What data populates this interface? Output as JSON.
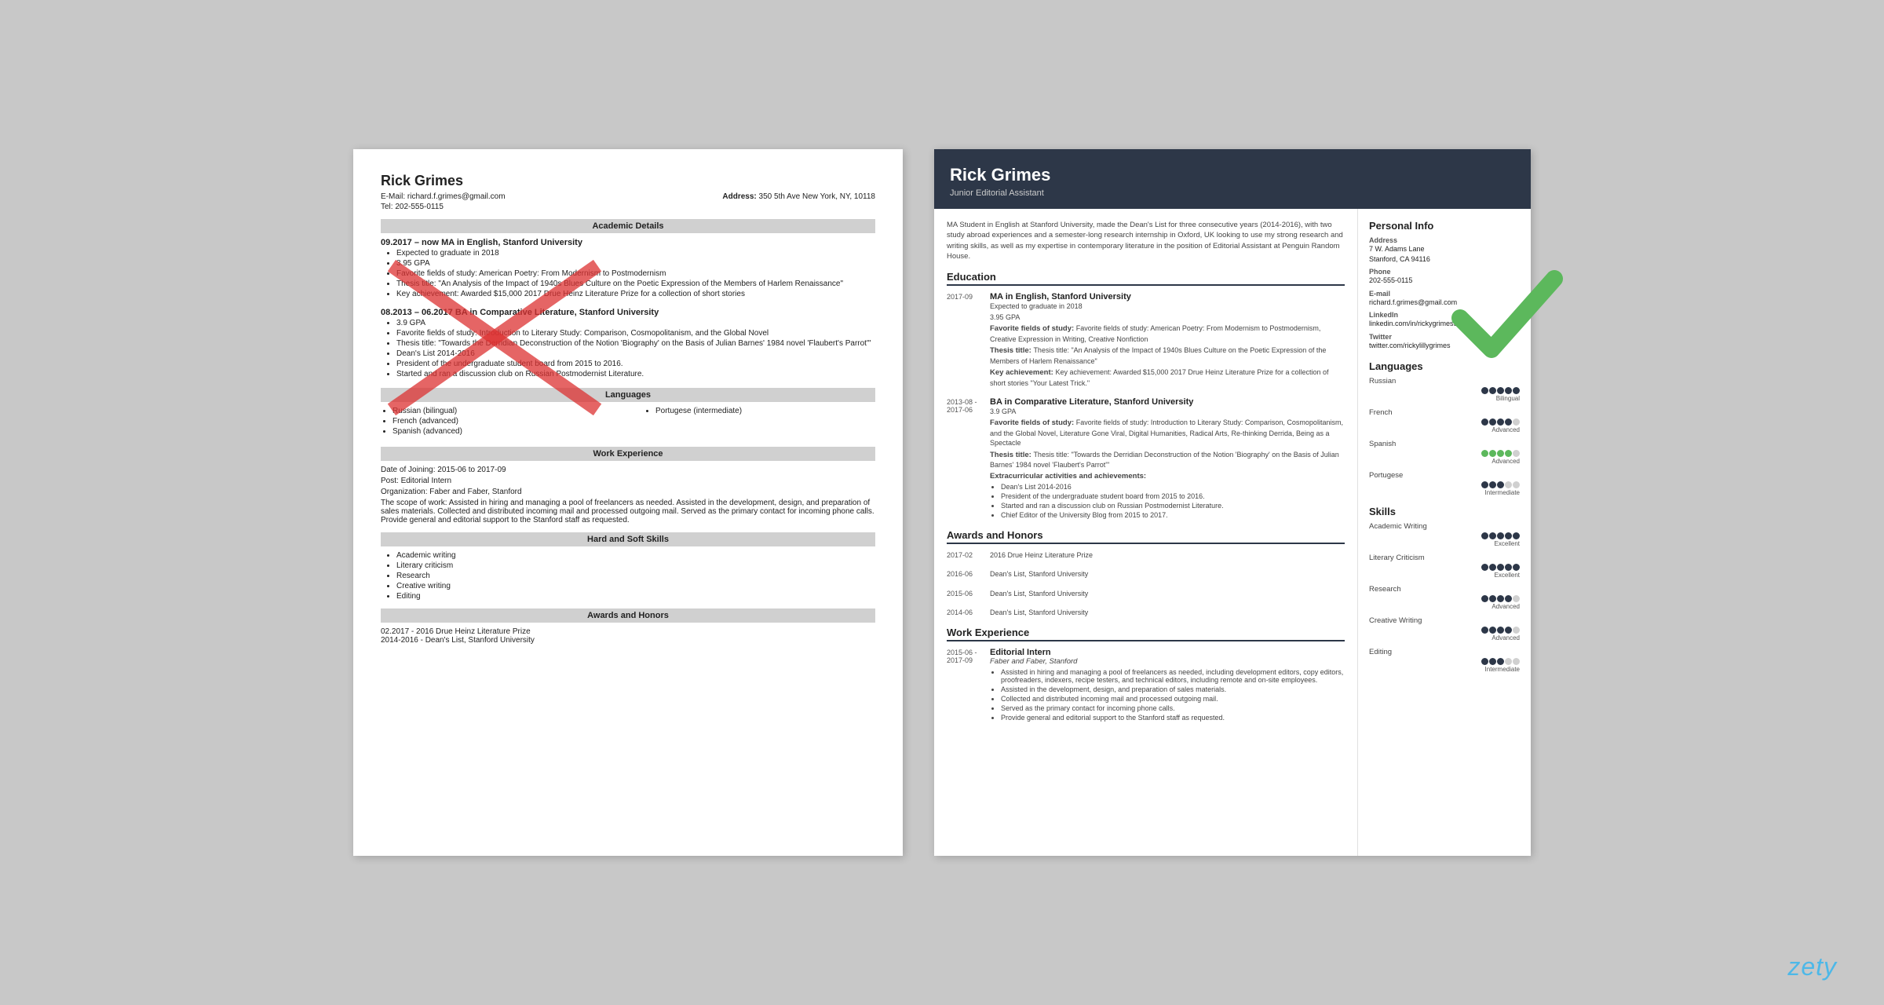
{
  "left_resume": {
    "name": "Rick Grimes",
    "email_label": "E-Mail:",
    "email": "richard.f.grimes@gmail.com",
    "address_label": "Address:",
    "address": "350 5th Ave New York, NY, 10118",
    "tel_label": "Tel:",
    "tel": "202-555-0115",
    "sections": {
      "academic": "Academic Details",
      "languages": "Languages",
      "work": "Work Experience",
      "skills": "Hard and Soft Skills",
      "awards": "Awards and Honors"
    },
    "edu": [
      {
        "date": "09.2017 – now",
        "degree": "MA in English, Stanford University",
        "bullets": [
          "Expected to graduate in 2018",
          "3.95 GPA",
          "Favorite fields of study: American Poetry: From Modernism to Postmodernism",
          "Thesis title: \"An Analysis of the Impact of 1940s Blues Culture on the Poetic Expression of the Members of Harlem Renaissance\"",
          "Key achievement: Awarded $15,000 2017 Drue Heinz Literature Prize for a collection of short stories"
        ]
      },
      {
        "date": "08.2013 – 06.2017",
        "degree": "BA in Comparative Literature, Stanford University",
        "bullets": [
          "3.9 GPA",
          "Favorite fields of study: Introduction to Literary Study: Comparison, Cosmopolitanism, and the Global Novel",
          "Thesis title: \"Towards the Derridian Deconstruction of the Notion 'Biography' on the Basis of Julian Barnes' 1984 novel 'Flaubert's Parrot'\"",
          "Dean's List 2014-2016",
          "President of the undergraduate student board from 2015 to 2016.",
          "Started and ran a discussion club on Russian Postmodernist Literature."
        ]
      }
    ],
    "languages": {
      "col1": [
        "Russian  (bilingual)",
        "French (advanced)",
        "Spanish (advanced)"
      ],
      "col2": [
        "Portugese (intermediate)"
      ]
    },
    "work": {
      "dates": "Date of Joining: 2015-06 to 2017-09",
      "post": "Post: Editorial Intern",
      "org": "Organization: Faber and Faber, Stanford",
      "scope": "The scope of work: Assisted in hiring and managing a pool of freelancers as needed. Assisted in the development, design, and preparation of sales materials. Collected and distributed incoming mail and processed outgoing mail. Served as the primary contact for incoming phone calls.  Provide general and editorial support to the Stanford staff as requested."
    },
    "skills": [
      "Academic writing",
      "Literary criticism",
      "Research",
      "Creative writing",
      "Editing"
    ],
    "awards": [
      "02.2017 - 2016 Drue Heinz Literature Prize",
      "2014-2016 - Dean's List, Stanford University"
    ]
  },
  "right_resume": {
    "name": "Rick Grimes",
    "subtitle": "Junior Editorial Assistant",
    "summary": "MA Student in English at Stanford University, made the Dean's List for three consecutive years (2014-2016), with two study abroad experiences and a semester-long research internship in Oxford, UK looking to use my strong research and writing skills, as well as my expertise in contemporary literature in the position of Editorial Assistant at Penguin Random House.",
    "sections": {
      "education": "Education",
      "awards": "Awards and Honors",
      "work": "Work Experience"
    },
    "education": [
      {
        "date": "2017-09",
        "title": "MA in English, Stanford University",
        "gpa": "Expected to graduate in 2018",
        "gpa2": "3.95 GPA",
        "fields": "Favorite fields of study: American Poetry: From Modernism to Postmodernism, Creative Expression in Writing, Creative Nonfiction",
        "thesis": "Thesis title: \"An Analysis of the Impact of 1940s Blues Culture on the Poetic Expression of the Members of Harlem Renaissance\"",
        "achievement": "Key achievement: Awarded $15,000 2017 Drue Heinz Literature Prize for a collection of short stories \"Your Latest Trick.\""
      },
      {
        "date": "2013-08 - 2017-06",
        "title": "BA in Comparative Literature, Stanford University",
        "gpa": "3.9 GPA",
        "fields": "Favorite fields of study: Introduction to Literary Study: Comparison, Cosmopolitanism, and the Global Novel, Literature Gone Viral, Digital Humanities, Radical Arts, Re-thinking Derrida, Being as a Spectacle",
        "thesis": "Thesis title: \"Towards the Derridian Deconstruction of the Notion 'Biography' on the Basis of Julian Barnes' 1984 novel 'Flaubert's Parrot'\"",
        "extracurricular_label": "Extracurricular activities and achievements:",
        "extracurricular": [
          "Dean's List 2014-2016",
          "President of the undergraduate student board from 2015 to 2016.",
          "Started and ran a discussion club on Russian Postmodernist Literature.",
          "Chief Editor of the University Blog from 2015 to 2017."
        ]
      }
    ],
    "awards": [
      {
        "date": "2017-02",
        "title": "2016 Drue Heinz Literature Prize"
      },
      {
        "date": "2016-06",
        "title": "Dean's List, Stanford University"
      },
      {
        "date": "2015-06",
        "title": "Dean's List, Stanford University"
      },
      {
        "date": "2014-06",
        "title": "Dean's List, Stanford University"
      }
    ],
    "work": [
      {
        "date": "2015-06 - 2017-09",
        "title": "Editorial Intern",
        "org": "Faber and Faber, Stanford",
        "bullets": [
          "Assisted in hiring and managing a pool of freelancers as needed, including development editors, copy editors, proofreaders, indexers, recipe testers, and technical editors, including remote and on-site employees.",
          "Assisted in the development, design, and preparation of sales materials.",
          "Collected and distributed incoming mail and processed outgoing mail.",
          "Served as the primary contact for incoming phone calls.",
          "Provide general and editorial support to the Stanford staff as requested."
        ]
      }
    ],
    "personal_info": {
      "section_title": "Personal Info",
      "address_label": "Address",
      "address": "7 W. Adams Lane\nStanford, CA 94116",
      "phone_label": "Phone",
      "phone": "202-555-0115",
      "email_label": "E-mail",
      "email": "richard.f.grimes@gmail.com",
      "linkedin_label": "LinkedIn",
      "linkedin": "linkedin.com/in/rickygrimes93",
      "twitter_label": "Twitter",
      "twitter": "twitter.com/rickylillygrimes"
    },
    "languages": {
      "section_title": "Languages",
      "items": [
        {
          "name": "Russian",
          "level": "Bilingual",
          "dots_filled": 5,
          "dots_total": 5,
          "color": "dark"
        },
        {
          "name": "French",
          "level": "Advanced",
          "dots_filled": 4,
          "dots_total": 5,
          "color": "dark"
        },
        {
          "name": "Spanish",
          "level": "Advanced",
          "dots_filled": 4,
          "dots_total": 5,
          "color": "green"
        },
        {
          "name": "Portugese",
          "level": "Intermediate",
          "dots_filled": 3,
          "dots_total": 5,
          "color": "dark"
        }
      ]
    },
    "skills": {
      "section_title": "Skills",
      "items": [
        {
          "name": "Academic Writing",
          "level": "Excellent",
          "dots_filled": 5,
          "dots_total": 5
        },
        {
          "name": "Literary Criticism",
          "level": "Excellent",
          "dots_filled": 5,
          "dots_total": 5
        },
        {
          "name": "Research",
          "level": "Advanced",
          "dots_filled": 4,
          "dots_total": 5
        },
        {
          "name": "Creative Writing",
          "level": "Advanced",
          "dots_filled": 4,
          "dots_total": 5
        },
        {
          "name": "Editing",
          "level": "Intermediate",
          "dots_filled": 3,
          "dots_total": 5
        }
      ]
    }
  },
  "zety": "zety"
}
